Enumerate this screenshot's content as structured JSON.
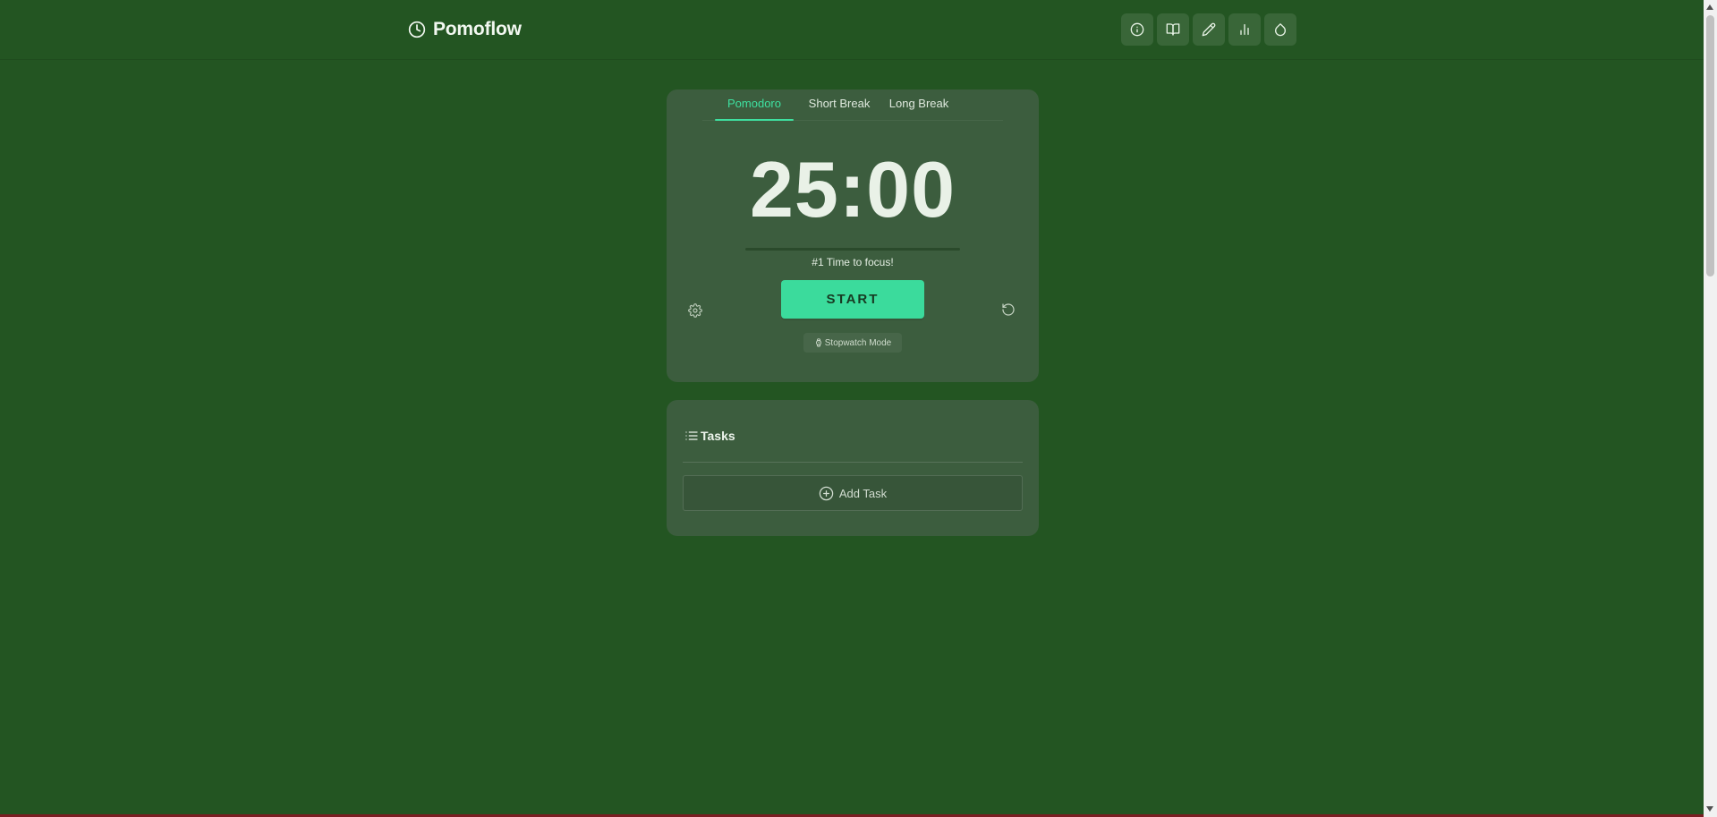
{
  "header": {
    "app_title": "Pomoflow",
    "nav_buttons": [
      "info-icon",
      "book-icon",
      "pencil-icon",
      "bar-chart-icon",
      "droplet-icon"
    ]
  },
  "timer": {
    "tabs": [
      {
        "label": "Pomodoro",
        "active": true
      },
      {
        "label": "Short Break",
        "active": false
      },
      {
        "label": "Long Break",
        "active": false
      }
    ],
    "time": "25:00",
    "progress": 0,
    "message": "#1 Time to focus!",
    "start_label": "START",
    "stopwatch_label": "Stopwatch Mode"
  },
  "tasks": {
    "title": "Tasks",
    "add_label": "Add Task"
  },
  "colors": {
    "background": "#235522",
    "card": "#3c5d3e",
    "accent": "#3bdb9c"
  }
}
